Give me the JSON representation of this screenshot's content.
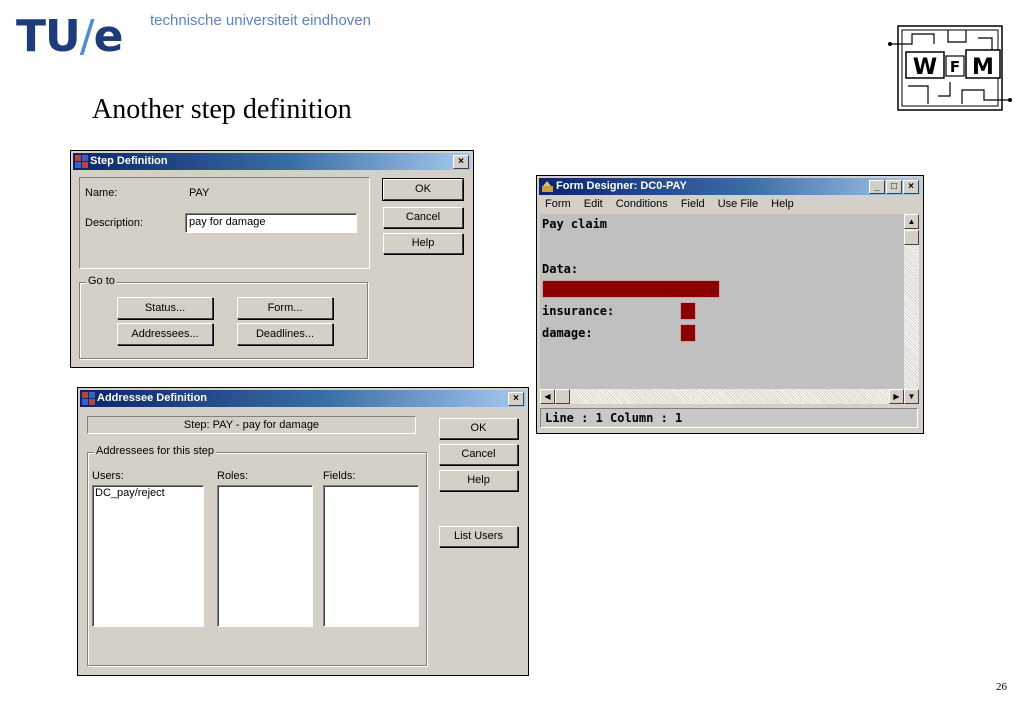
{
  "header": {
    "logo_tu": "TU",
    "logo_slash": "/",
    "logo_e": "e",
    "university": "technische universiteit eindhoven",
    "logo_right_text_w": "W",
    "logo_right_text_f": "F",
    "logo_right_text_m": "M"
  },
  "slide": {
    "title": "Another step definition",
    "page_number": "26"
  },
  "step_definition": {
    "title": "Step Definition",
    "close": "×",
    "name_label": "Name:",
    "name_value": "PAY",
    "description_label": "Description:",
    "description_value": "pay for damage",
    "ok_label": "OK",
    "cancel_label": "Cancel",
    "help_label": "Help",
    "goto_label": "Go to",
    "status_label": "Status...",
    "form_label": "Form...",
    "addressees_label": "Addressees...",
    "deadlines_label": "Deadlines..."
  },
  "addressee_definition": {
    "title": "Addressee Definition",
    "close": "×",
    "step_text": "Step:  PAY - pay for damage",
    "group_label": "Addressees for this step",
    "users_label": "Users:",
    "roles_label": "Roles:",
    "fields_label": "Fields:",
    "users_items": [
      "DC_pay/reject"
    ],
    "ok_label": "OK",
    "cancel_label": "Cancel",
    "help_label": "Help",
    "list_users_label": "List Users"
  },
  "form_designer": {
    "title": "Form Designer:  DC0-PAY",
    "minimize": "_",
    "maximize": "□",
    "close": "×",
    "menu": [
      "Form",
      "Edit",
      "Conditions",
      "Field",
      "Use File",
      "Help"
    ],
    "line1": "Pay claim",
    "line2": "Data:",
    "line3": "insurance:",
    "line4": "damage:",
    "status": "Line : 1  Column : 1",
    "field_color": "#8b0000"
  },
  "colors": {
    "titlebar_start": "#0a246a",
    "window_bg": "#d4d0c8",
    "brand_blue": "#1f3c7a"
  }
}
